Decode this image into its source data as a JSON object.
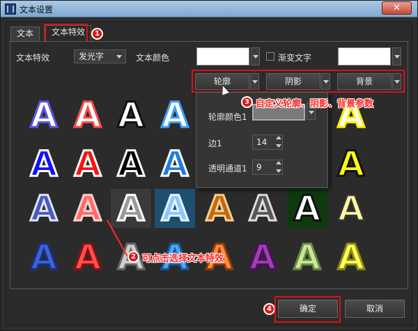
{
  "window": {
    "title": "文本设置",
    "close_label": "✕"
  },
  "tabs": [
    {
      "label": "文本"
    },
    {
      "label": "文本特效"
    }
  ],
  "effect_row": {
    "effect_label": "文本特效",
    "effect_value": "发光字",
    "color_label": "文本颜色",
    "gradient_label": "渐变文字"
  },
  "detail_buttons": [
    {
      "label": "轮廓"
    },
    {
      "label": "阴影"
    },
    {
      "label": "背景"
    }
  ],
  "popup": {
    "outline_color_label": "轮廓颜色1",
    "edge_label": "边1",
    "edge_value": "14",
    "alpha_label": "透明通道1",
    "alpha_value": "9"
  },
  "annotations": {
    "badge1": "1",
    "badge2": "2",
    "badge3": "3",
    "badge4": "4",
    "note2": "可点击选择文本特效",
    "note3": "自定义轮廓、阴影、背景参数"
  },
  "grid_glyph": "A",
  "effects": [
    {
      "fill": "#ffffff",
      "stroke": "#5a55e0",
      "bg": "transparent"
    },
    {
      "fill": "#ffffff",
      "stroke": "#ff4a4a",
      "bg": "transparent"
    },
    {
      "fill": "#ffffff",
      "stroke": "#111111",
      "bg": "transparent"
    },
    {
      "fill": "#ffffff",
      "stroke": "#3ca0ff",
      "bg": "transparent"
    },
    {
      "fill": "#ffffff",
      "stroke": "#ffee00",
      "bg": "transparent"
    },
    {
      "fill": "#1010ff",
      "stroke": "#ffffff",
      "bg": "transparent"
    },
    {
      "fill": "#ff1010",
      "stroke": "#ffffff",
      "bg": "transparent"
    },
    {
      "fill": "#000000",
      "stroke": "#ffffff",
      "bg": "transparent"
    },
    {
      "fill": "#1e7ce6",
      "stroke": "#ffffff",
      "bg": "transparent"
    },
    {
      "fill": "#ffff10",
      "stroke": "#111111",
      "bg": "transparent"
    },
    {
      "fill": "#4a5ab8",
      "stroke": "#dfe3ff",
      "bg": "transparent"
    },
    {
      "fill": "#ff6a6a",
      "stroke": "#ffd0d0",
      "bg": "transparent"
    },
    {
      "fill": "#9a9a9a",
      "stroke": "#ffffff",
      "bg": "#3a3a3a"
    },
    {
      "fill": "#88c8ff",
      "stroke": "#e8f4ff",
      "bg": "#1f4f6f"
    },
    {
      "fill": "#c06a10",
      "stroke": "#ffcf90",
      "bg": "transparent"
    },
    {
      "fill": "#555555",
      "stroke": "#dddddd",
      "bg": "transparent"
    },
    {
      "fill": "#ffffff",
      "stroke": "#111111",
      "bg": "#0f3a10"
    },
    {
      "fill": "#fff8a0",
      "stroke": "#333333",
      "bg": "#2a2a2a"
    },
    {
      "fill": "#3d62d8",
      "stroke": "#1a2f7a",
      "bg": "transparent"
    },
    {
      "fill": "#ff4f4f",
      "stroke": "#8a1010",
      "bg": "transparent"
    },
    {
      "fill": "#cfcfcf",
      "stroke": "#666666",
      "bg": "transparent"
    },
    {
      "fill": "#4aa8ff",
      "stroke": "#1a5a9a",
      "bg": "transparent"
    },
    {
      "fill": "#ff8a3a",
      "stroke": "#8a3a10",
      "bg": "transparent"
    },
    {
      "fill": "#a040b0",
      "stroke": "#4a1060",
      "bg": "transparent"
    },
    {
      "fill": "#c8e8a0",
      "stroke": "#6a8a40",
      "bg": "transparent"
    },
    {
      "fill": "#ffff60",
      "stroke": "#8a8a10",
      "bg": "transparent"
    }
  ],
  "footer": {
    "ok_label": "确定",
    "cancel_label": "取消"
  }
}
